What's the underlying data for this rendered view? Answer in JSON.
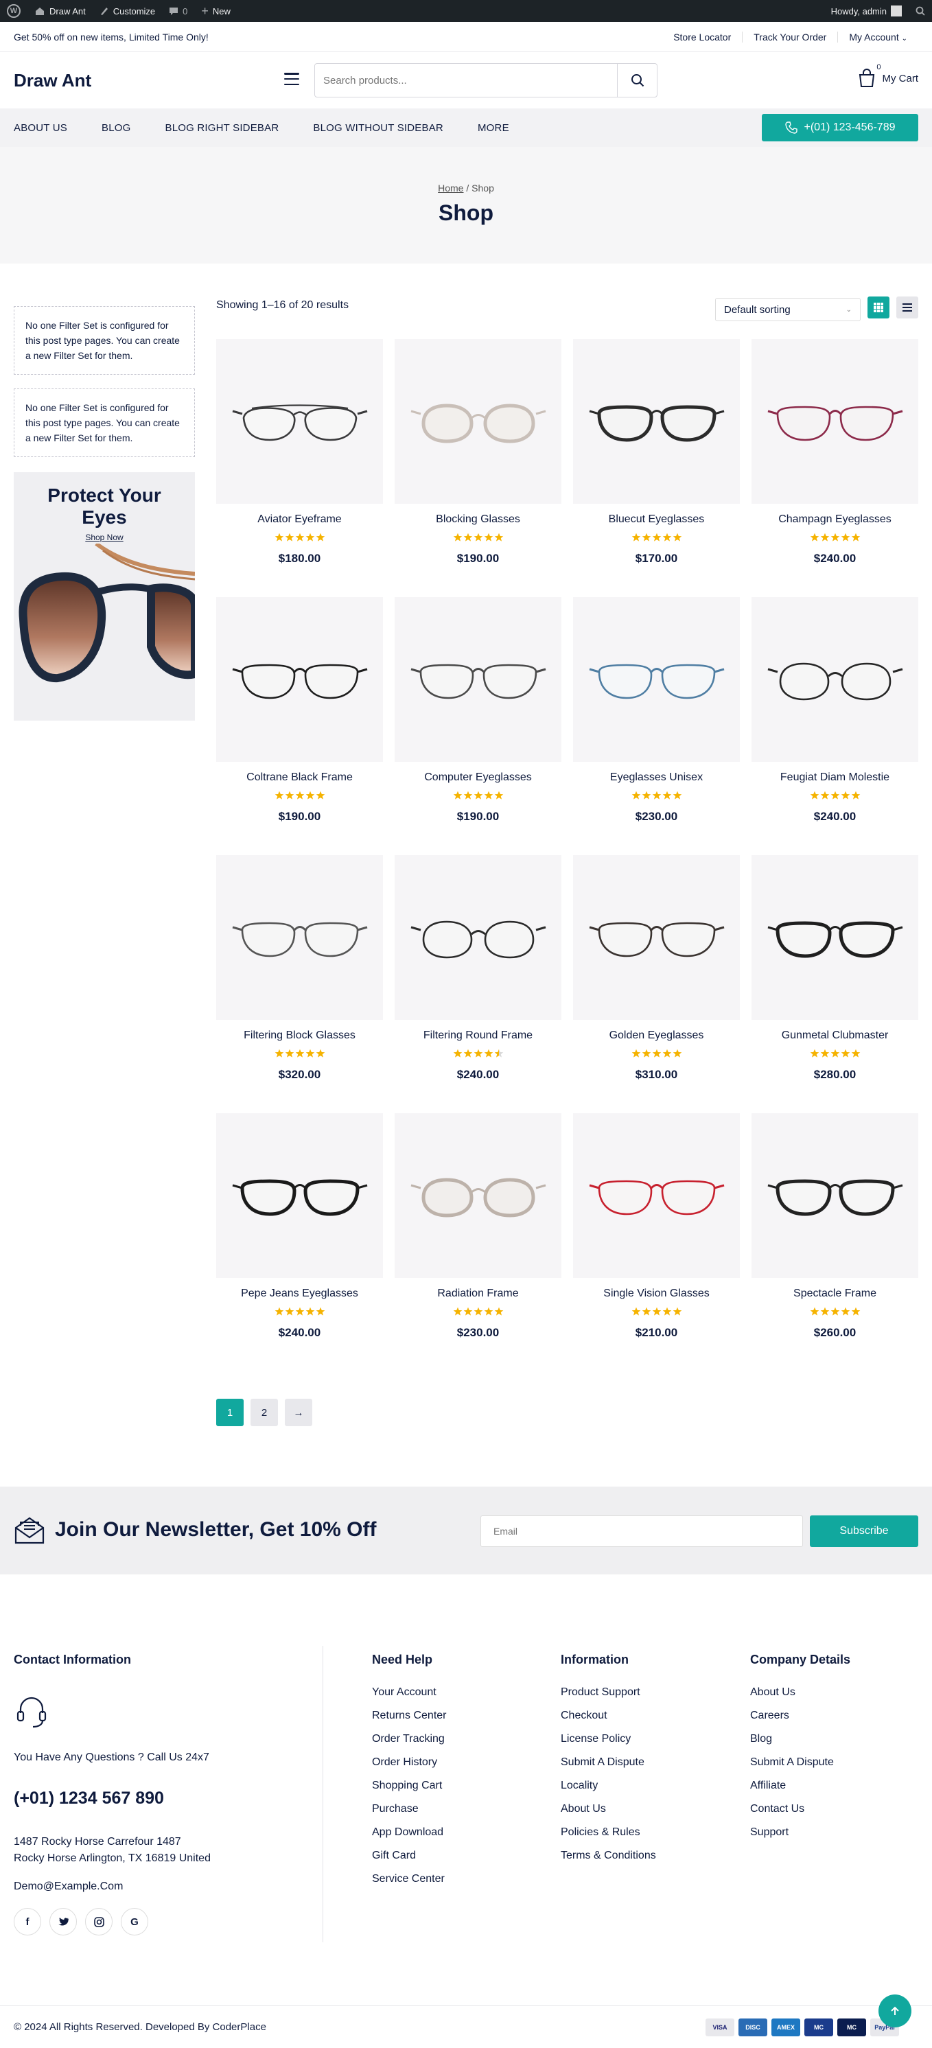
{
  "adminbar": {
    "site_name": "Draw Ant",
    "customize": "Customize",
    "comments": "0",
    "new": "New",
    "howdy": "Howdy, admin"
  },
  "topbar": {
    "promo": "Get 50% off on new items, Limited Time Only!",
    "store_locator": "Store Locator",
    "track_order": "Track Your Order",
    "my_account": "My Account"
  },
  "header": {
    "logo": "Draw Ant",
    "search_placeholder": "Search products...",
    "cart_label": "My Cart",
    "cart_count": "0"
  },
  "nav": {
    "items": [
      "ABOUT US",
      "BLOG",
      "BLOG RIGHT SIDEBAR",
      "BLOG WITHOUT SIDEBAR",
      "MORE"
    ],
    "phone": "+(01) 123-456-789"
  },
  "hero": {
    "breadcrumb_home": "Home",
    "breadcrumb_sep": " / ",
    "breadcrumb_current": "Shop",
    "title": "Shop"
  },
  "sidebar": {
    "filter_notice_1": "No one Filter Set is configured for this post type pages. You can create a new Filter Set for them.",
    "filter_notice_2": "No one Filter Set is configured for this post type pages. You can create a new Filter Set for them.",
    "promo_title": "Protect Your Eyes",
    "promo_link": "Shop Now"
  },
  "shop": {
    "results": "Showing 1–16 of 20 results",
    "sorting": "Default sorting"
  },
  "products": [
    {
      "name": "Aviator Eyeframe",
      "price": "$180.00",
      "rating": 5,
      "frame_color": "#3a3a3c",
      "lens": "#f7f7f7",
      "style": "aviator"
    },
    {
      "name": "Blocking Glasses",
      "price": "$190.00",
      "rating": 5,
      "frame_color": "#c9bfb8",
      "lens": "#f2efec",
      "style": "round-clear"
    },
    {
      "name": "Bluecut Eyeglasses",
      "price": "$170.00",
      "rating": 5,
      "frame_color": "#2b2b2b",
      "lens": "#f4f4f4",
      "style": "thick"
    },
    {
      "name": "Champagn Eyeglasses",
      "price": "$240.00",
      "rating": 5,
      "frame_color": "#8c2a4a",
      "lens": "#f5f3f4",
      "style": "thin"
    },
    {
      "name": "Coltrane Black Frame",
      "price": "$190.00",
      "rating": 5,
      "frame_color": "#1e1e1e",
      "lens": "#f6f6f6",
      "style": "thin"
    },
    {
      "name": "Computer Eyeglasses",
      "price": "$190.00",
      "rating": 5,
      "frame_color": "#4a4a4a",
      "lens": "#f6f6f6",
      "style": "thin"
    },
    {
      "name": "Eyeglasses Unisex",
      "price": "$230.00",
      "rating": 5,
      "frame_color": "#4f7ea3",
      "lens": "#f5f7f9",
      "style": "thin"
    },
    {
      "name": "Feugiat Diam Molestie",
      "price": "$240.00",
      "rating": 5,
      "frame_color": "#262626",
      "lens": "#f6f6f6",
      "style": "round"
    },
    {
      "name": "Filtering Block Glasses",
      "price": "$320.00",
      "rating": 5,
      "frame_color": "#555555",
      "lens": "#f6f6f6",
      "style": "thin"
    },
    {
      "name": "Filtering Round Frame",
      "price": "$240.00",
      "rating": 4.5,
      "frame_color": "#2a2a2a",
      "lens": "#f6f6f6",
      "style": "round"
    },
    {
      "name": "Golden Eyeglasses",
      "price": "$310.00",
      "rating": 5,
      "frame_color": "#3a3330",
      "lens": "#f6f6f6",
      "style": "thin"
    },
    {
      "name": "Gunmetal Clubmaster",
      "price": "$280.00",
      "rating": 5,
      "frame_color": "#1f1f1f",
      "lens": "#f6f6f6",
      "style": "thick"
    },
    {
      "name": "Pepe Jeans Eyeglasses",
      "price": "$240.00",
      "rating": 5,
      "frame_color": "#1a1a1a",
      "lens": "#f6f6f6",
      "style": "thick"
    },
    {
      "name": "Radiation Frame",
      "price": "$230.00",
      "rating": 5,
      "frame_color": "#bdb2aa",
      "lens": "#f1eeec",
      "style": "round-clear"
    },
    {
      "name": "Single Vision Glasses",
      "price": "$210.00",
      "rating": 5,
      "frame_color": "#c7202e",
      "lens": "#f7f5f5",
      "style": "thin"
    },
    {
      "name": "Spectacle Frame",
      "price": "$260.00",
      "rating": 5,
      "frame_color": "#222222",
      "lens": "#f6f6f6",
      "style": "thick"
    }
  ],
  "pagination": {
    "pages": [
      "1",
      "2"
    ],
    "next": "→"
  },
  "newsletter": {
    "title": "Join Our Newsletter, Get 10% Off",
    "email_placeholder": "Email",
    "button": "Subscribe"
  },
  "footer": {
    "contact": {
      "title": "Contact Information",
      "question": "You Have Any Questions ? Call Us 24x7",
      "phone": "(+01) 1234 567 890",
      "address_1": "1487 Rocky Horse Carrefour 1487",
      "address_2": "Rocky Horse Arlington, TX 16819 United",
      "email": "Demo@Example.Com"
    },
    "need_help": {
      "title": "Need Help",
      "links": [
        "Your Account",
        "Returns Center",
        "Order Tracking",
        "Order History",
        "Shopping Cart",
        "Purchase",
        "App Download",
        "Gift Card",
        "Service Center"
      ]
    },
    "information": {
      "title": "Information",
      "links": [
        "Product Support",
        "Checkout",
        "License Policy",
        "Submit A Dispute",
        "Locality",
        "About Us",
        "Policies & Rules",
        "Terms & Conditions"
      ]
    },
    "company": {
      "title": "Company Details",
      "links": [
        "About Us",
        "Careers",
        "Blog",
        "Submit A Dispute",
        "Affiliate",
        "Contact Us",
        "Support"
      ]
    },
    "copyright": "© 2024 All Rights Reserved. Developed By CoderPlace",
    "payments": [
      "VISA",
      "DISC",
      "AMEX",
      "MC",
      "MC",
      "PayPal"
    ]
  },
  "colors": {
    "accent": "#11a89e",
    "navy": "#0f1b3d",
    "star": "#f5b301"
  }
}
